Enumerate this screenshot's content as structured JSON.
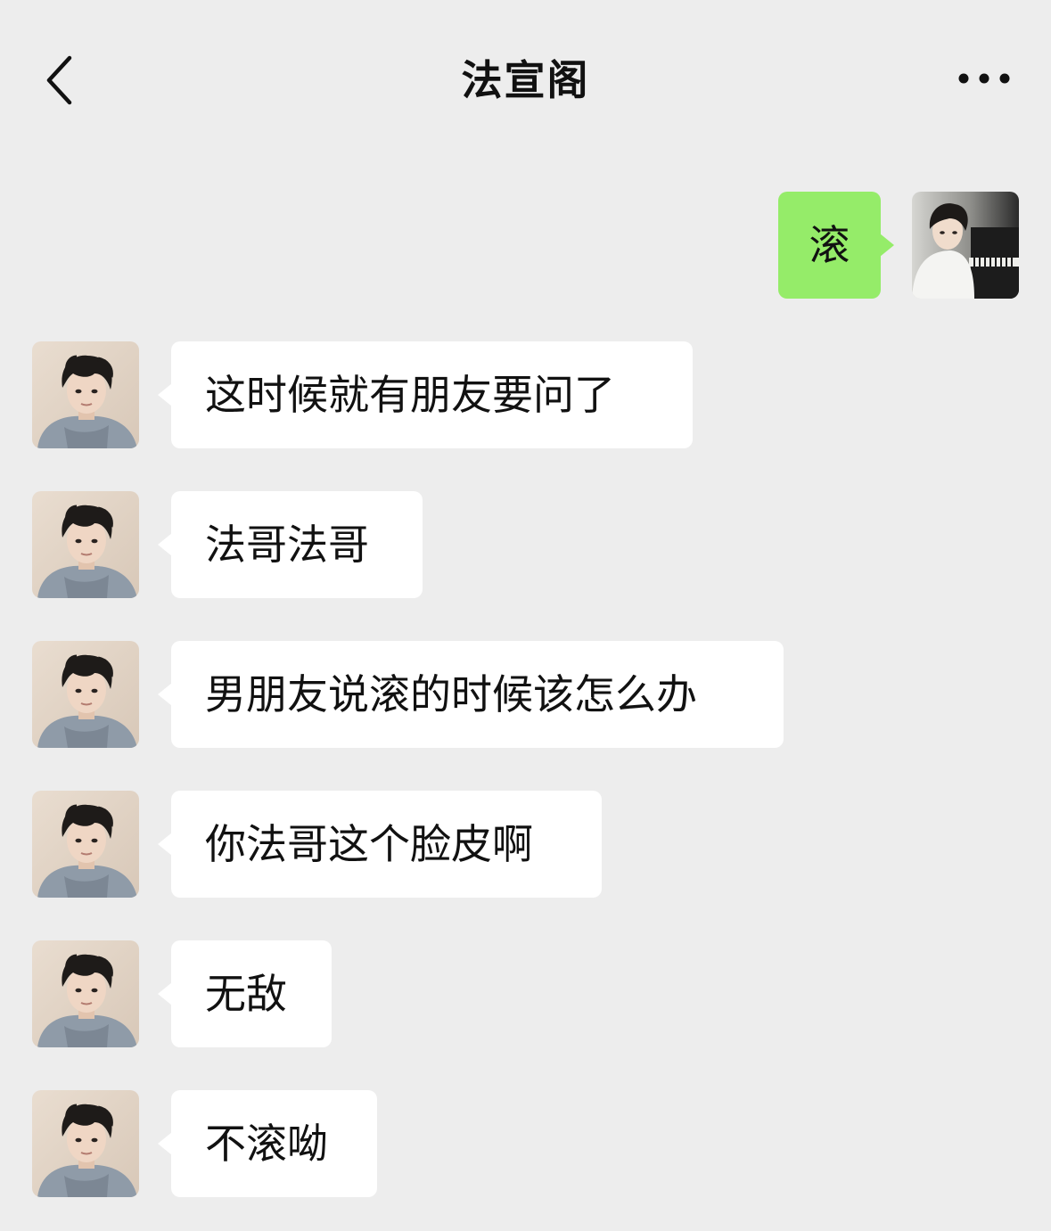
{
  "header": {
    "title": "法宣阁",
    "back_icon": "chevron-left-icon",
    "more_icon": "more-dots-icon"
  },
  "colors": {
    "background": "#ededed",
    "sent_bubble": "#95ec69",
    "received_bubble": "#ffffff"
  },
  "messages": [
    {
      "sender": "me",
      "text": "滚"
    },
    {
      "sender": "contact",
      "text": "这时候就有朋友要问了"
    },
    {
      "sender": "contact",
      "text": "法哥法哥"
    },
    {
      "sender": "contact",
      "text": "男朋友说滚的时候该怎么办"
    },
    {
      "sender": "contact",
      "text": "你法哥这个脸皮啊"
    },
    {
      "sender": "contact",
      "text": "无敌"
    },
    {
      "sender": "contact",
      "text": "不滚呦"
    }
  ]
}
